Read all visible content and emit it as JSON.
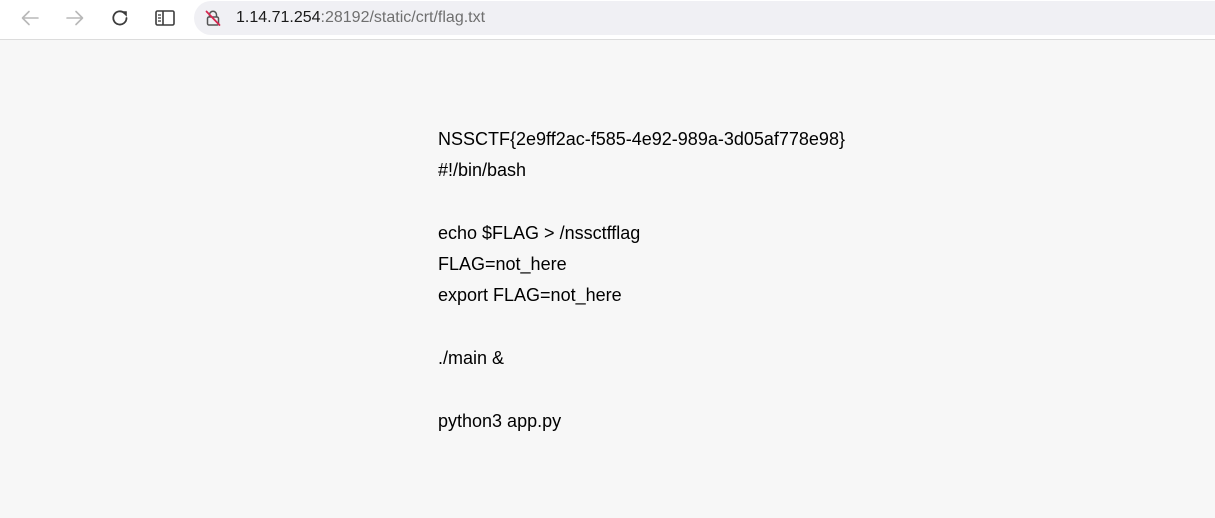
{
  "browser": {
    "address_bar": {
      "host": "1.14.71.254",
      "rest": ":28192/static/crt/flag.txt"
    },
    "icons": {
      "back": "arrow-left-icon",
      "forward": "arrow-right-icon",
      "reload": "reload-icon",
      "reader": "reader-view-icon",
      "security": "insecure-lock-icon"
    }
  },
  "document": {
    "lines": [
      "NSSCTF{2e9ff2ac-f585-4e92-989a-3d05af778e98}",
      "#!/bin/bash",
      "",
      "echo $FLAG > /nssctfflag",
      "FLAG=not_here",
      "export FLAG=not_here",
      "",
      "./main &",
      "",
      "python3 app.py"
    ]
  }
}
